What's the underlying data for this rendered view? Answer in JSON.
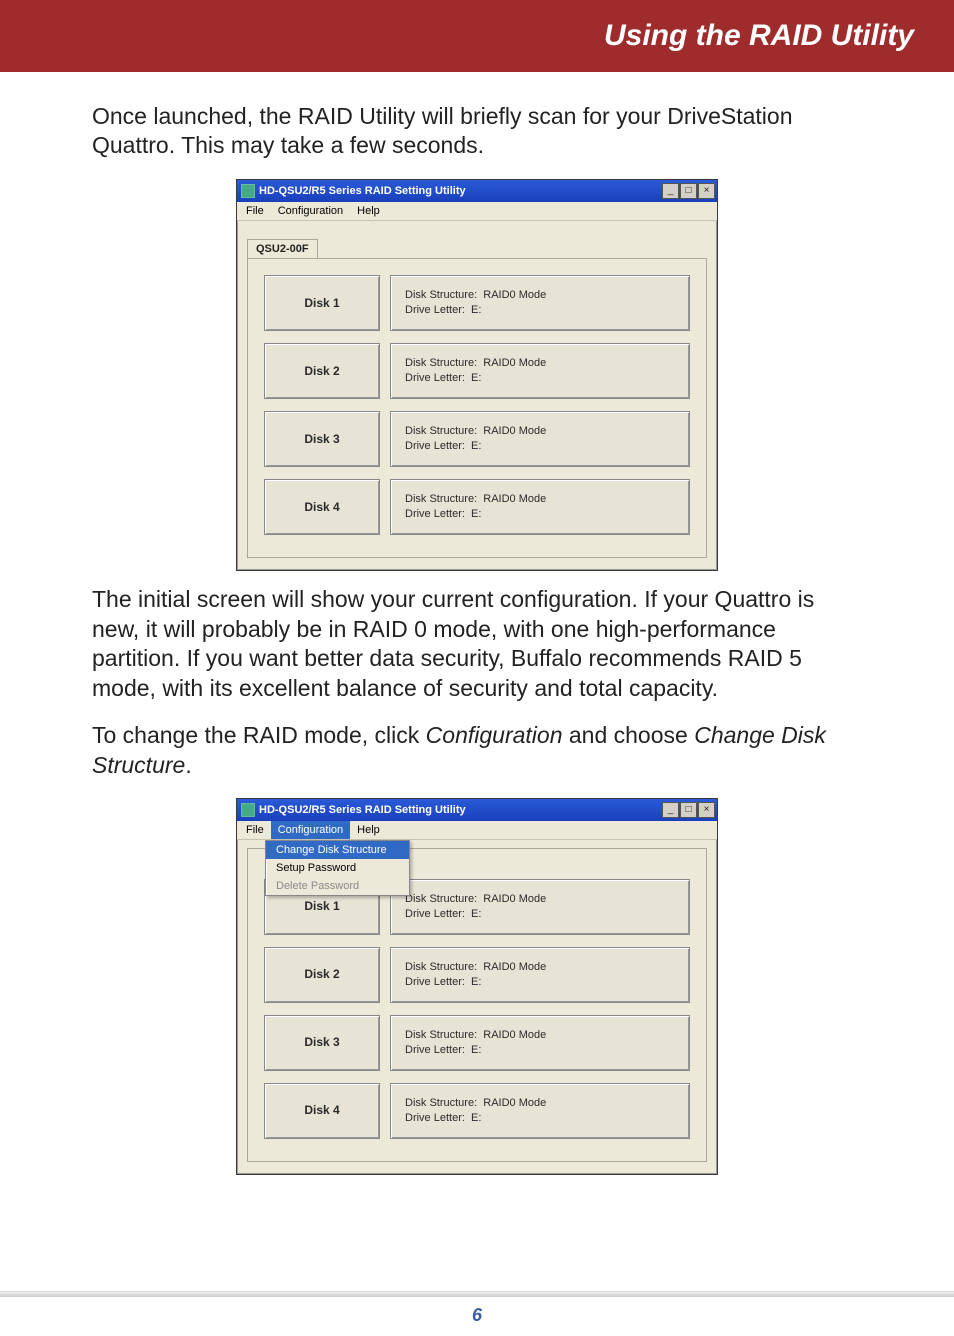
{
  "header": {
    "title": "Using the RAID Utility"
  },
  "para1": "Once launched, the RAID Utility will briefly scan for your DriveStation Quattro.  This may take a few seconds.",
  "para2": "The initial screen will show your current configuration.  If your Quattro is new, it will probably be in RAID 0 mode, with one high-performance partition.  If you want better data security, Buffalo recommends RAID 5 mode, with its excellent balance of security and total capacity.",
  "para3_pre": "To change the RAID mode, click ",
  "para3_em1": "Configuration",
  "para3_mid": " and choose ",
  "para3_em2": "Change Disk Structure",
  "para3_post": ".",
  "page_number": "6",
  "win_title": "HD-QSU2/R5 Series RAID Setting Utility",
  "menus": {
    "file": "File",
    "config": "Configuration",
    "help": "Help"
  },
  "dropdown": {
    "change": "Change Disk Structure",
    "setup": "Setup Password",
    "delete": "Delete Password"
  },
  "tab_label": "QSU2-00F",
  "disk_struct_label": "Disk Structure:",
  "drive_letter_label": "Drive Letter:",
  "disks": [
    {
      "name": "Disk 1",
      "struct": "RAID0 Mode",
      "letter": "E:"
    },
    {
      "name": "Disk 2",
      "struct": "RAID0 Mode",
      "letter": "E:"
    },
    {
      "name": "Disk 3",
      "struct": "RAID0 Mode",
      "letter": "E:"
    },
    {
      "name": "Disk 4",
      "struct": "RAID0 Mode",
      "letter": "E:"
    }
  ],
  "win_btns": {
    "min": "_",
    "max": "□",
    "close": "×"
  }
}
